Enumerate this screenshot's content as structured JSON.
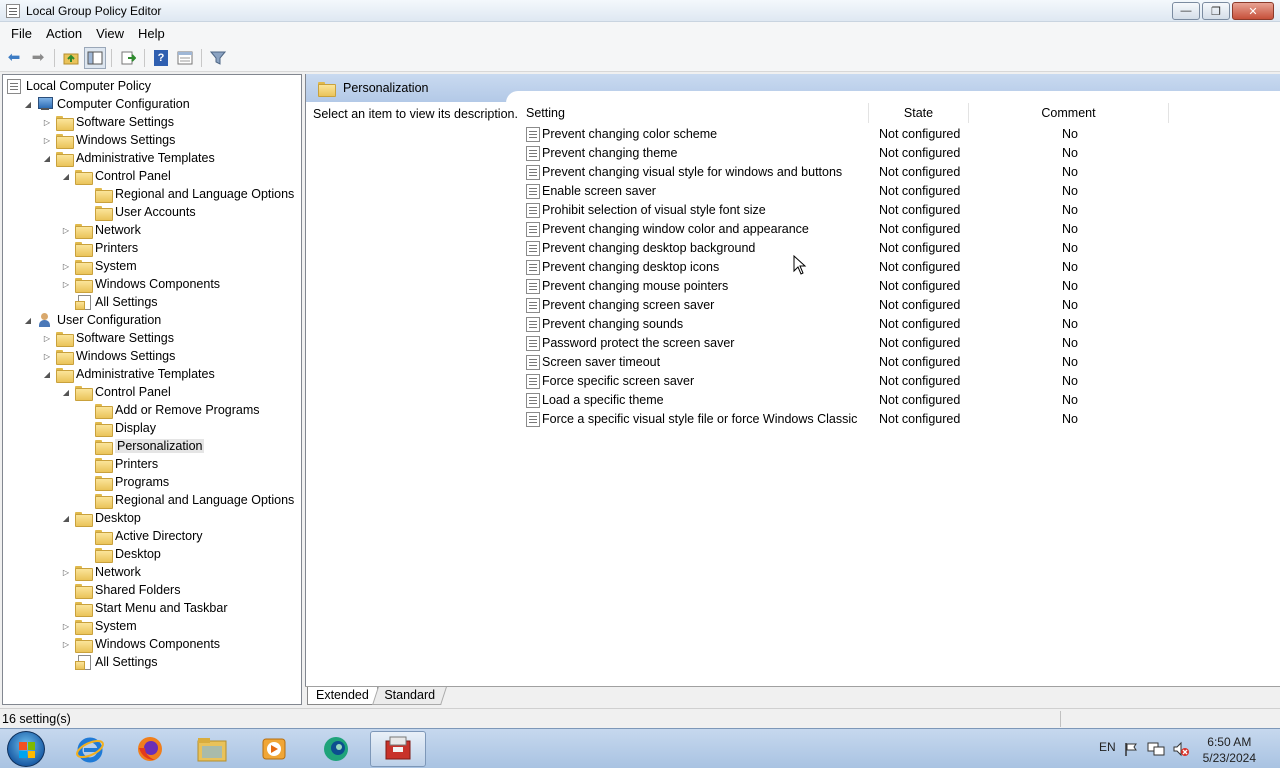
{
  "window": {
    "title": "Local Group Policy Editor"
  },
  "menu": [
    "File",
    "Action",
    "View",
    "Help"
  ],
  "tree": [
    {
      "label": "Local Computer Policy",
      "level": 0,
      "icon": "doc",
      "exp": ""
    },
    {
      "label": "Computer Configuration",
      "level": 1,
      "icon": "pc",
      "exp": "open"
    },
    {
      "label": "Software Settings",
      "level": 2,
      "icon": "folder",
      "exp": "closed"
    },
    {
      "label": "Windows Settings",
      "level": 2,
      "icon": "folder",
      "exp": "closed"
    },
    {
      "label": "Administrative Templates",
      "level": 2,
      "icon": "folder",
      "exp": "open"
    },
    {
      "label": "Control Panel",
      "level": 3,
      "icon": "folder",
      "exp": "open"
    },
    {
      "label": "Regional and Language Options",
      "level": 4,
      "icon": "folder",
      "exp": ""
    },
    {
      "label": "User Accounts",
      "level": 4,
      "icon": "folder",
      "exp": ""
    },
    {
      "label": "Network",
      "level": 3,
      "icon": "folder",
      "exp": "closed"
    },
    {
      "label": "Printers",
      "level": 3,
      "icon": "folder",
      "exp": ""
    },
    {
      "label": "System",
      "level": 3,
      "icon": "folder",
      "exp": "closed"
    },
    {
      "label": "Windows Components",
      "level": 3,
      "icon": "folder",
      "exp": "closed"
    },
    {
      "label": "All Settings",
      "level": 3,
      "icon": "allset",
      "exp": ""
    },
    {
      "label": "User Configuration",
      "level": 1,
      "icon": "user",
      "exp": "open"
    },
    {
      "label": "Software Settings",
      "level": 2,
      "icon": "folder",
      "exp": "closed"
    },
    {
      "label": "Windows Settings",
      "level": 2,
      "icon": "folder",
      "exp": "closed"
    },
    {
      "label": "Administrative Templates",
      "level": 2,
      "icon": "folder",
      "exp": "open"
    },
    {
      "label": "Control Panel",
      "level": 3,
      "icon": "folder",
      "exp": "open"
    },
    {
      "label": "Add or Remove Programs",
      "level": 4,
      "icon": "folder",
      "exp": ""
    },
    {
      "label": "Display",
      "level": 4,
      "icon": "folder",
      "exp": ""
    },
    {
      "label": "Personalization",
      "level": 4,
      "icon": "folder",
      "exp": "",
      "selected": true
    },
    {
      "label": "Printers",
      "level": 4,
      "icon": "folder",
      "exp": ""
    },
    {
      "label": "Programs",
      "level": 4,
      "icon": "folder",
      "exp": ""
    },
    {
      "label": "Regional and Language Options",
      "level": 4,
      "icon": "folder",
      "exp": ""
    },
    {
      "label": "Desktop",
      "level": 3,
      "icon": "folder",
      "exp": "open"
    },
    {
      "label": "Active Directory",
      "level": 4,
      "icon": "folder",
      "exp": ""
    },
    {
      "label": "Desktop",
      "level": 4,
      "icon": "folder",
      "exp": ""
    },
    {
      "label": "Network",
      "level": 3,
      "icon": "folder",
      "exp": "closed"
    },
    {
      "label": "Shared Folders",
      "level": 3,
      "icon": "folder",
      "exp": ""
    },
    {
      "label": "Start Menu and Taskbar",
      "level": 3,
      "icon": "folder",
      "exp": ""
    },
    {
      "label": "System",
      "level": 3,
      "icon": "folder",
      "exp": "closed"
    },
    {
      "label": "Windows Components",
      "level": 3,
      "icon": "folder",
      "exp": "closed"
    },
    {
      "label": "All Settings",
      "level": 3,
      "icon": "allset",
      "exp": ""
    }
  ],
  "details": {
    "header": "Personalization",
    "description": "Select an item to view its description.",
    "columns": {
      "setting": "Setting",
      "state": "State",
      "comment": "Comment"
    },
    "rows": [
      {
        "setting": "Prevent changing color scheme",
        "state": "Not configured",
        "comment": "No"
      },
      {
        "setting": "Prevent changing theme",
        "state": "Not configured",
        "comment": "No"
      },
      {
        "setting": "Prevent changing visual style for windows and buttons",
        "state": "Not configured",
        "comment": "No"
      },
      {
        "setting": "Enable screen saver",
        "state": "Not configured",
        "comment": "No"
      },
      {
        "setting": "Prohibit selection of visual style font size",
        "state": "Not configured",
        "comment": "No"
      },
      {
        "setting": "Prevent changing window color and appearance",
        "state": "Not configured",
        "comment": "No"
      },
      {
        "setting": "Prevent changing desktop background",
        "state": "Not configured",
        "comment": "No"
      },
      {
        "setting": "Prevent changing desktop icons",
        "state": "Not configured",
        "comment": "No"
      },
      {
        "setting": "Prevent changing mouse pointers",
        "state": "Not configured",
        "comment": "No"
      },
      {
        "setting": "Prevent changing screen saver",
        "state": "Not configured",
        "comment": "No"
      },
      {
        "setting": "Prevent changing sounds",
        "state": "Not configured",
        "comment": "No"
      },
      {
        "setting": "Password protect the screen saver",
        "state": "Not configured",
        "comment": "No"
      },
      {
        "setting": "Screen saver timeout",
        "state": "Not configured",
        "comment": "No"
      },
      {
        "setting": "Force specific screen saver",
        "state": "Not configured",
        "comment": "No"
      },
      {
        "setting": "Load a specific theme",
        "state": "Not configured",
        "comment": "No"
      },
      {
        "setting": "Force a specific visual style file or force Windows Classic",
        "state": "Not configured",
        "comment": "No"
      }
    ]
  },
  "tabs": {
    "extended": "Extended",
    "standard": "Standard"
  },
  "status": {
    "text": "16 setting(s)"
  },
  "taskbar": {
    "lang": "EN",
    "time": "6:50 AM",
    "date": "5/23/2024",
    "apps": [
      "internet-explorer-icon",
      "firefox-icon",
      "file-explorer-icon",
      "media-player-icon",
      "browser-icon",
      "group-policy-icon"
    ]
  },
  "colors": {
    "header_bg": "#b8cde9",
    "taskbar": "#b5cbe6",
    "selection": "#e5e5e5"
  }
}
